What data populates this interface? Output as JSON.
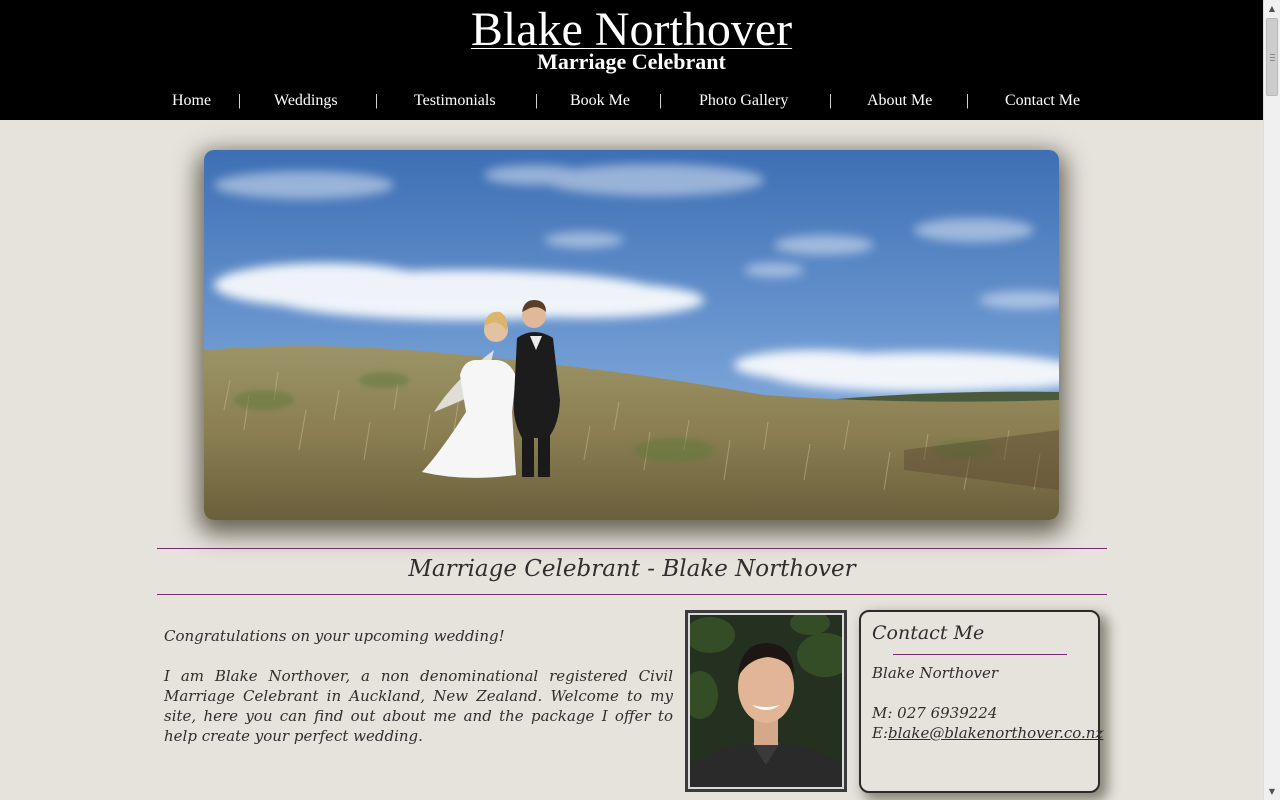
{
  "header": {
    "title": "Blake Northover",
    "subtitle": "Marriage Celebrant"
  },
  "nav": {
    "items": [
      "Home",
      "Weddings",
      "Testimonials",
      "Book Me",
      "Photo Gallery",
      "About Me",
      "Contact Me"
    ],
    "separator": "|"
  },
  "hero": {
    "image": "wedding-couple-on-dunes"
  },
  "main": {
    "section_title": "Marriage Celebrant - Blake Northover",
    "intro_greeting": "Congratulations on your upcoming wedding!",
    "intro_body": "I am Blake Northover, a non denominational registered Civil Marriage Celebrant in Auckland, New Zealand. Welcome to my site, here you can find out about me and the package I offer to help create your perfect wedding."
  },
  "contact": {
    "heading": "Contact Me",
    "name": "Blake Northover",
    "mobile": "M: 027 6939224",
    "email_prefix": "E:",
    "email": "blake@blakenorthover.co.nz"
  },
  "colors": {
    "header_bg": "#000000",
    "page_bg": "#e6e3dc",
    "accent_rule": "#7a2a6e",
    "text": "#2e2e2e"
  }
}
